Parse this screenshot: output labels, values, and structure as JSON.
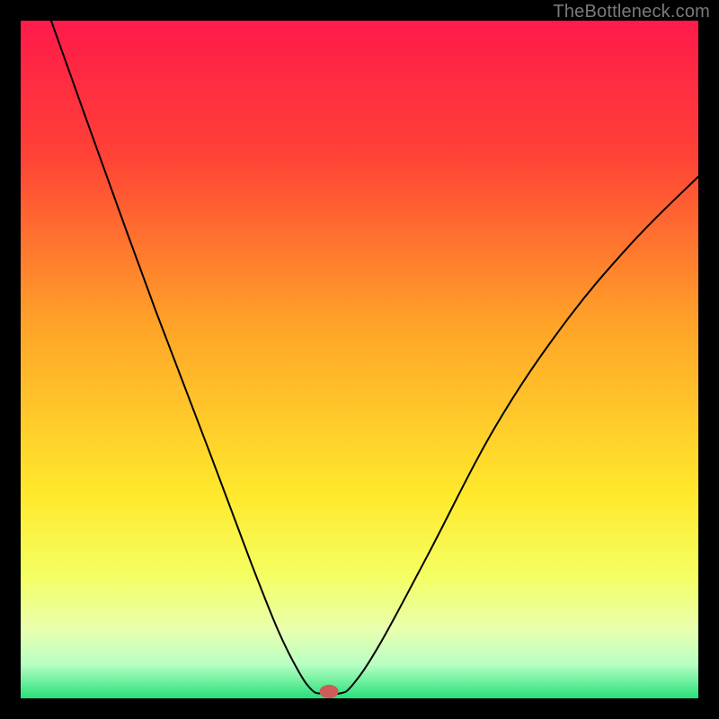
{
  "watermark": "TheBottleneck.com",
  "chart_data": {
    "type": "line",
    "title": "",
    "xlabel": "",
    "ylabel": "",
    "xlim": [
      0,
      100
    ],
    "ylim": [
      0,
      100
    ],
    "grid": false,
    "legend": false,
    "axes_visible": false,
    "background_gradient": {
      "stops": [
        {
          "offset": 0.0,
          "color": "#ff1a4b"
        },
        {
          "offset": 0.2,
          "color": "#ff4236"
        },
        {
          "offset": 0.45,
          "color": "#ffa428"
        },
        {
          "offset": 0.7,
          "color": "#ffe92c"
        },
        {
          "offset": 0.82,
          "color": "#f4ff63"
        },
        {
          "offset": 0.9,
          "color": "#e8ffb0"
        },
        {
          "offset": 0.95,
          "color": "#b8ffc3"
        },
        {
          "offset": 1.0,
          "color": "#26e07a"
        }
      ]
    },
    "series": [
      {
        "name": "bottleneck-curve",
        "stroke": "#000000",
        "stroke_width": 2,
        "points": [
          {
            "x": 4.5,
            "y": 100.0
          },
          {
            "x": 12.0,
            "y": 79.0
          },
          {
            "x": 20.0,
            "y": 57.0
          },
          {
            "x": 28.0,
            "y": 36.0
          },
          {
            "x": 34.0,
            "y": 20.0
          },
          {
            "x": 38.0,
            "y": 10.0
          },
          {
            "x": 41.0,
            "y": 4.0
          },
          {
            "x": 43.0,
            "y": 1.2
          },
          {
            "x": 44.5,
            "y": 0.7
          },
          {
            "x": 47.0,
            "y": 0.7
          },
          {
            "x": 49.0,
            "y": 2.0
          },
          {
            "x": 53.0,
            "y": 8.0
          },
          {
            "x": 60.0,
            "y": 21.0
          },
          {
            "x": 70.0,
            "y": 40.0
          },
          {
            "x": 80.0,
            "y": 55.0
          },
          {
            "x": 90.0,
            "y": 67.0
          },
          {
            "x": 100.0,
            "y": 77.0
          }
        ]
      }
    ],
    "markers": [
      {
        "name": "optimal-point",
        "x": 45.5,
        "y": 1.0,
        "rx": 1.4,
        "ry": 1.0,
        "fill": "#cc5c55"
      }
    ]
  }
}
